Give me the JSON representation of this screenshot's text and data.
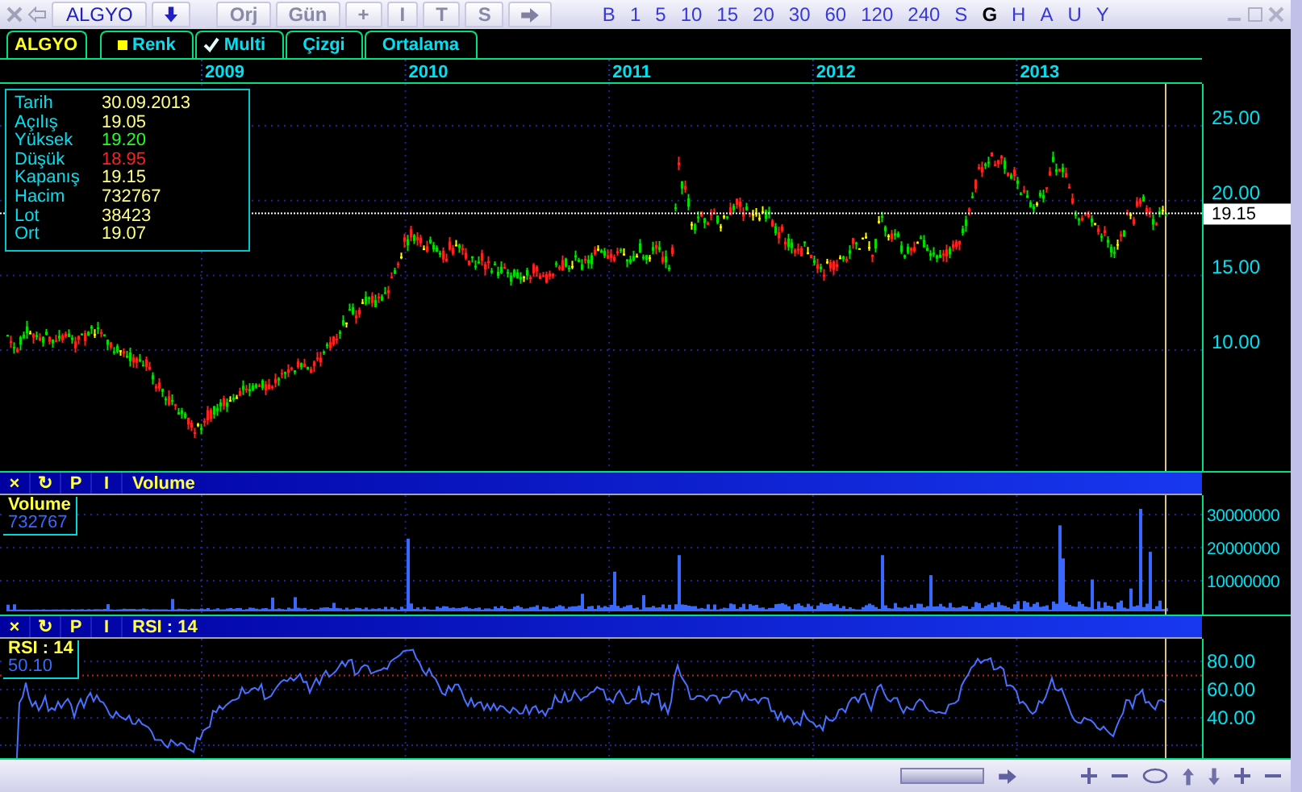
{
  "toolbar": {
    "symbol": "ALGYO",
    "buttons": [
      "Orj",
      "Gün",
      "+",
      "I",
      "T",
      "S"
    ],
    "periods": [
      {
        "label": "B",
        "selected": false
      },
      {
        "label": "1",
        "selected": false
      },
      {
        "label": "5",
        "selected": false
      },
      {
        "label": "10",
        "selected": false
      },
      {
        "label": "15",
        "selected": false
      },
      {
        "label": "20",
        "selected": false
      },
      {
        "label": "30",
        "selected": false
      },
      {
        "label": "60",
        "selected": false
      },
      {
        "label": "120",
        "selected": false
      },
      {
        "label": "240",
        "selected": false
      },
      {
        "label": "S",
        "selected": false
      },
      {
        "label": "G",
        "selected": true
      },
      {
        "label": "H",
        "selected": false
      },
      {
        "label": "A",
        "selected": false
      },
      {
        "label": "U",
        "selected": false
      },
      {
        "label": "Y",
        "selected": false
      }
    ]
  },
  "tabs": {
    "symbol": "ALGYO",
    "items": [
      {
        "label": "Renk",
        "kind": "swatch"
      },
      {
        "label": "Multi",
        "kind": "check",
        "checked": true
      },
      {
        "label": "Çizgi",
        "kind": "plain"
      },
      {
        "label": "Ortalama",
        "kind": "plain"
      }
    ]
  },
  "years": [
    "2009",
    "2010",
    "2011",
    "2012",
    "2013"
  ],
  "info": [
    {
      "label": "Tarih",
      "value": "30.09.2013",
      "color": "#ffff80"
    },
    {
      "label": "Açılış",
      "value": "19.05",
      "color": "#ffff80"
    },
    {
      "label": "Yüksek",
      "value": "19.20",
      "color": "#20ff20"
    },
    {
      "label": "Düşük",
      "value": "18.95",
      "color": "#ff2020"
    },
    {
      "label": "Kapanış",
      "value": "19.15",
      "color": "#ffff80"
    },
    {
      "label": "Hacim",
      "value": "732767",
      "color": "#ffff80"
    },
    {
      "label": "Lot",
      "value": "38423",
      "color": "#ffff80"
    },
    {
      "label": "Ort",
      "value": "19.07",
      "color": "#ffff80"
    }
  ],
  "price_axis": {
    "ticks": [
      "25.00",
      "20.00",
      "15.00",
      "10.00"
    ],
    "last": "19.15"
  },
  "panels": [
    {
      "kind": "volume",
      "tools": [
        "×",
        "↻",
        "P",
        "I"
      ],
      "title": "Volume",
      "legend_name": "Volume",
      "legend_value": "732767",
      "ticks": [
        "30000000",
        "20000000",
        "10000000"
      ]
    },
    {
      "kind": "rsi",
      "tools": [
        "×",
        "↻",
        "P",
        "I"
      ],
      "title": "RSI : 14",
      "legend_name": "RSI : 14",
      "legend_value": "50.10",
      "ticks": [
        "80.00",
        "60.00",
        "40.00"
      ]
    }
  ]
}
